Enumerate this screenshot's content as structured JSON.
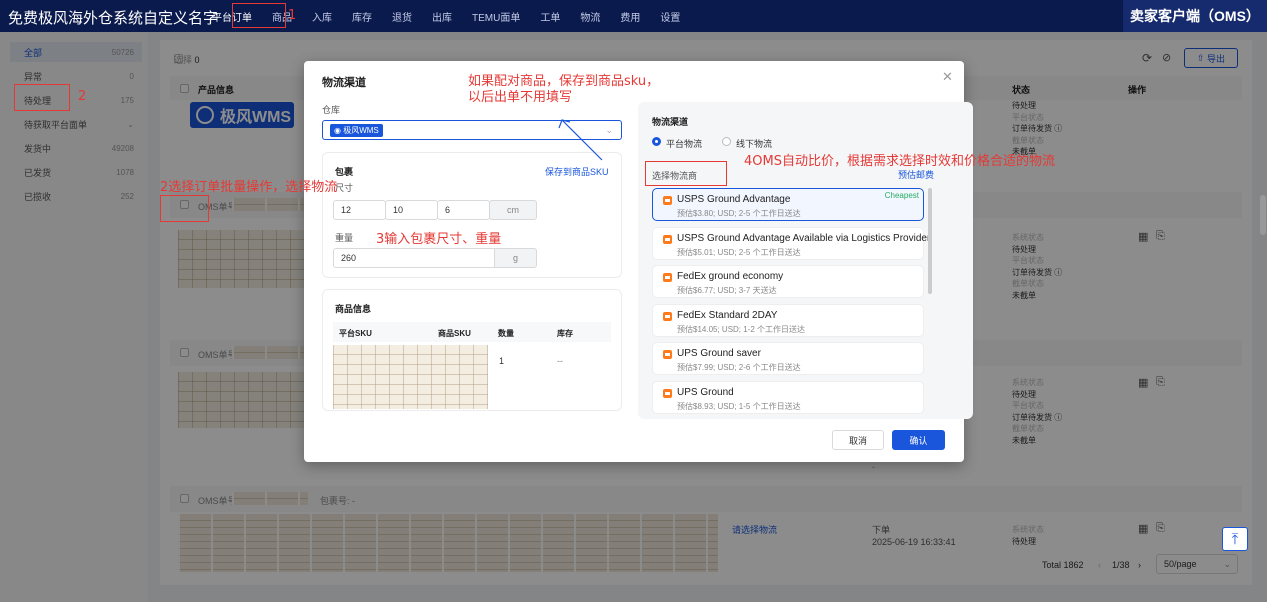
{
  "app": {
    "brand": "免费极风海外仓系统自定义名字",
    "oms_title": "卖家客户端（OMS）",
    "nav": [
      "平台订单",
      "商品",
      "入库",
      "库存",
      "退货",
      "出库",
      "TEMU面单",
      "工单",
      "物流",
      "费用",
      "设置"
    ],
    "nav_active_index": 0
  },
  "sidebar": {
    "items": [
      {
        "label": "全部",
        "count": "50726"
      },
      {
        "label": "异常",
        "count": "0"
      },
      {
        "label": "待处理",
        "count": "175"
      },
      {
        "label": "待获取平台面单",
        "count": "⌄"
      },
      {
        "label": "发货中",
        "count": "49208"
      },
      {
        "label": "已发货",
        "count": "1078"
      },
      {
        "label": "已揽收",
        "count": "252"
      }
    ],
    "selected_index": 0
  },
  "main": {
    "selected_label": "选择",
    "selected_count": "0",
    "export_label": "导出",
    "col_product": "产品信息",
    "col_status": "状态",
    "col_action": "操作",
    "order_no_label": "OMS单号",
    "package_no_label": "包裹号: -",
    "select_channel_link": "请选择物流",
    "order_stage": "下单",
    "order_time": "2025-06-19 16:33:41",
    "dash": "-",
    "status_lines": [
      "系统状态",
      "待处理",
      "平台状态",
      "订单待发货 ⓘ",
      "截单状态",
      "未截单"
    ],
    "status_top": [
      "待处理",
      "平台状态",
      "订单待发货 ⓘ",
      "截单状态",
      "未截单"
    ],
    "status_bottom": [
      "系统状态",
      "待处理"
    ],
    "total_label": "Total 1862",
    "page_label": "1/38",
    "page_size": "50/page"
  },
  "watermark": "极风WMS",
  "dialog": {
    "title": "物流渠道",
    "warehouse_label": "仓库",
    "warehouse_value": "极风WMS",
    "package_title": "包裹",
    "size_label": "尺寸",
    "size_values": [
      "12",
      "10",
      "6"
    ],
    "size_unit": "cm",
    "weight_label": "重量",
    "weight_value": "260",
    "weight_unit": "g",
    "save_sku_link": "保存到商品SKU",
    "goods_title": "商品信息",
    "goods_cols": [
      "平台SKU",
      "商品SKU",
      "数量",
      "库存"
    ],
    "goods_qty": "1",
    "goods_stock": "--",
    "channel_title": "物流渠道",
    "radio_platform": "平台物流",
    "radio_offline": "线下物流",
    "carrier_label": "选择物流商",
    "estimate_link": "预估邮费",
    "options": [
      {
        "name": "USPS Ground Advantage",
        "detail": "预估$3.80; USD; 2-5 个工作日送达",
        "tag": "Cheapest"
      },
      {
        "name": "USPS Ground Advantage Available via Logistics Provider",
        "detail": "预估$5.01; USD; 2-5 个工作日送达",
        "tag": ""
      },
      {
        "name": "FedEx ground economy",
        "detail": "预估$6.77; USD; 3-7 天送达",
        "tag": ""
      },
      {
        "name": "FedEx Standard 2DAY",
        "detail": "预估$14.05; USD; 1-2 个工作日送达",
        "tag": ""
      },
      {
        "name": "UPS Ground saver",
        "detail": "预估$7.99; USD; 2-6 个工作日送达",
        "tag": ""
      },
      {
        "name": "UPS Ground",
        "detail": "预估$8.93; USD; 1-5 个工作日送达",
        "tag": ""
      }
    ],
    "cancel_label": "取消",
    "confirm_label": "确认"
  },
  "annotations": {
    "n1": "1",
    "n2": "2",
    "a2": "2选择订单批量操作，选择物流",
    "a3": "3输入包裹尺寸、重量",
    "a4": "4OMS自动比价，根据需求选择时效和价格合适的物流",
    "a_sku": "如果配对商品，保存到商品sku，\n以后出单不用填写"
  },
  "colors": {
    "accent": "#1a56db",
    "topbar": "#0b1a4d",
    "annotation": "#e53935",
    "cheapest": "#27ae60",
    "carrier_icon": "#ff7a1a"
  }
}
